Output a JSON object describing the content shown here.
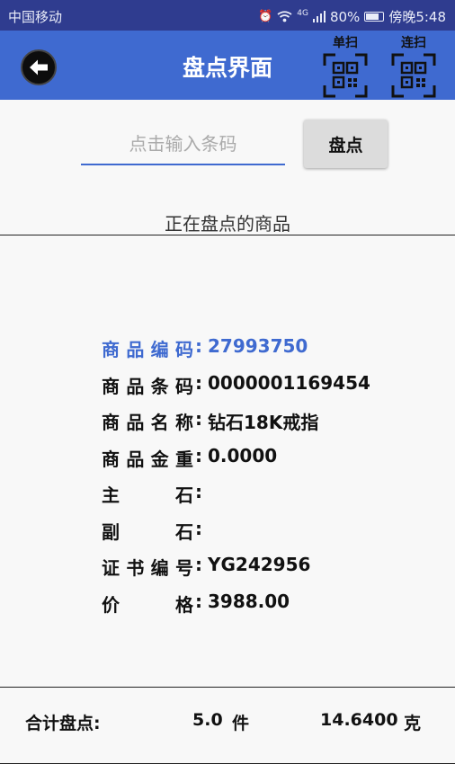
{
  "status_bar": {
    "carrier": "中国移动",
    "signal_tag": "4G",
    "battery": "80%",
    "battery_level": 0.8,
    "time": "傍晚5:48"
  },
  "app_bar": {
    "title": "盘点界面",
    "single_scan_label": "单扫",
    "continuous_scan_label": "连扫",
    "accent_color": "#3f6ad0"
  },
  "search": {
    "placeholder": "点击输入条码",
    "value": "",
    "button_label": "盘点"
  },
  "section_title": "正在盘点的商品",
  "product": {
    "fields": [
      {
        "label": "商品编码",
        "value": "27993750",
        "highlight": true
      },
      {
        "label": "商品条码",
        "value": "0000001169454"
      },
      {
        "label": "商品名称",
        "value": "钻石18K戒指"
      },
      {
        "label": "商品金重",
        "value": "0.0000"
      },
      {
        "label": "主石",
        "value": ""
      },
      {
        "label": "副石",
        "value": ""
      },
      {
        "label": "证书编号",
        "value": "YG242956"
      },
      {
        "label": "价格",
        "value": "3988.00"
      }
    ]
  },
  "footer": {
    "label": "合计盘点:",
    "count": "5.0",
    "count_unit": "件",
    "weight": "14.6400",
    "weight_unit": "克"
  }
}
